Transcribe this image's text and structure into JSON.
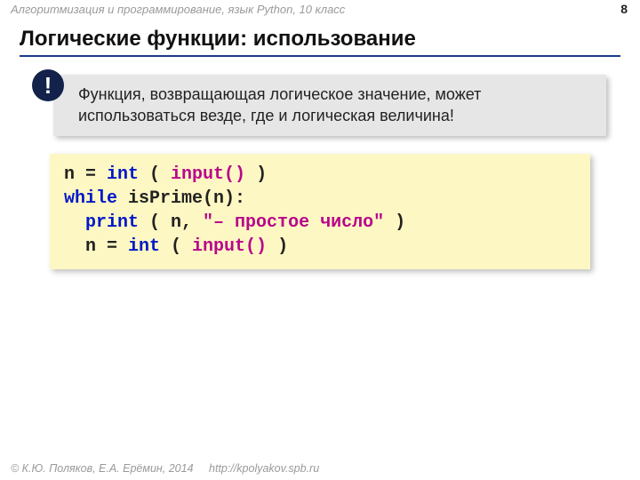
{
  "header": {
    "subtitle": "Алгоритмизация и программирование, язык Python, 10 класс",
    "page": "8"
  },
  "title": "Логические функции: использование",
  "note": {
    "bang": "!",
    "text": "Функция, возвращающая логическое значение, может использоваться везде, где и логическая величина!"
  },
  "code": {
    "l1": {
      "a": "n = ",
      "b": "int",
      "c": " ( ",
      "d": "input()",
      "e": " )"
    },
    "l2": {
      "a": "while",
      "b": " isPrime(n):"
    },
    "l3": {
      "a": "  ",
      "b": "print",
      "c": " ( n, ",
      "d": "\"– простое число\"",
      "e": " )"
    },
    "l4": {
      "a": "  n = ",
      "b": "int",
      "c": " ( ",
      "d": "input()",
      "e": " )"
    }
  },
  "footer": {
    "copyright": "© К.Ю. Поляков, Е.А. Ерёмин, 2014",
    "url": "http://kpolyakov.spb.ru"
  }
}
